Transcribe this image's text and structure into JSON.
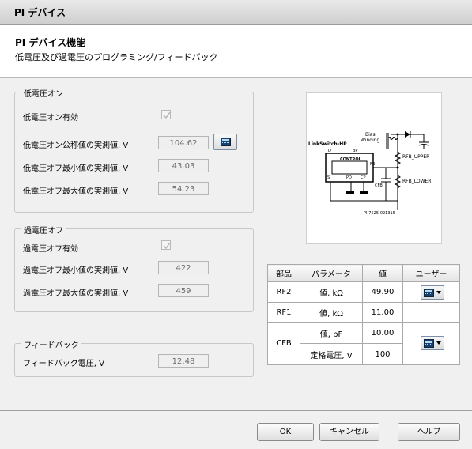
{
  "window": {
    "title": "PI デバイス"
  },
  "header": {
    "title": "PI デバイス機能",
    "subtitle": "低電圧及び過電圧のプログラミング/フィードバック"
  },
  "undervoltage": {
    "group_label": "低電圧オン",
    "enable_label": "低電圧オン有効",
    "enabled": true,
    "nominal_label": "低電圧オン公称値の実測値, V",
    "nominal_value": "104.62",
    "off_min_label": "低電圧オフ最小値の実測値, V",
    "off_min_value": "43.03",
    "off_max_label": "低電圧オフ最大値の実測値, V",
    "off_max_value": "54.23"
  },
  "overvoltage": {
    "group_label": "過電圧オフ",
    "enable_label": "過電圧オフ有効",
    "enabled": true,
    "off_min_label": "過電圧オフ最小値の実測値, V",
    "off_min_value": "422",
    "off_max_label": "過電圧オフ最大値の実測値, V",
    "off_max_value": "459"
  },
  "feedback": {
    "group_label": "フィードバック",
    "voltage_label": "フィードバック電圧, V",
    "voltage_value": "12.48"
  },
  "schematic": {
    "chip": "LinkSwitch-HP",
    "pin_d": "D",
    "pin_bp": "BP",
    "pin_fb": "FB",
    "pin_s": "S",
    "pin_pd": "PD",
    "pin_cp": "CP",
    "block": "CONTROL",
    "bias": "Bias",
    "winding": "Winding",
    "rfb_upper": "RFB_UPPER",
    "rfb_lower": "RFB_LOWER",
    "cfb": "CFB",
    "drawing_no": "PI-7525-021315"
  },
  "components": {
    "headers": [
      "部品",
      "パラメータ",
      "値",
      "ユーザー"
    ],
    "rf2": {
      "part": "RF2",
      "param": "値, kΩ",
      "value": "49.90"
    },
    "rf1": {
      "part": "RF1",
      "param": "値, kΩ",
      "value": "11.00"
    },
    "cfb": {
      "part": "CFB",
      "param1": "値, pF",
      "value1": "10.00",
      "param2": "定格電圧, V",
      "value2": "100"
    }
  },
  "buttons": {
    "ok": "OK",
    "cancel": "キャンセル",
    "help": "ヘルプ"
  },
  "icons": {
    "calculator": "calculator-icon",
    "dropdown": "chevron-down-icon",
    "checkbox": "checkmark-icon"
  }
}
